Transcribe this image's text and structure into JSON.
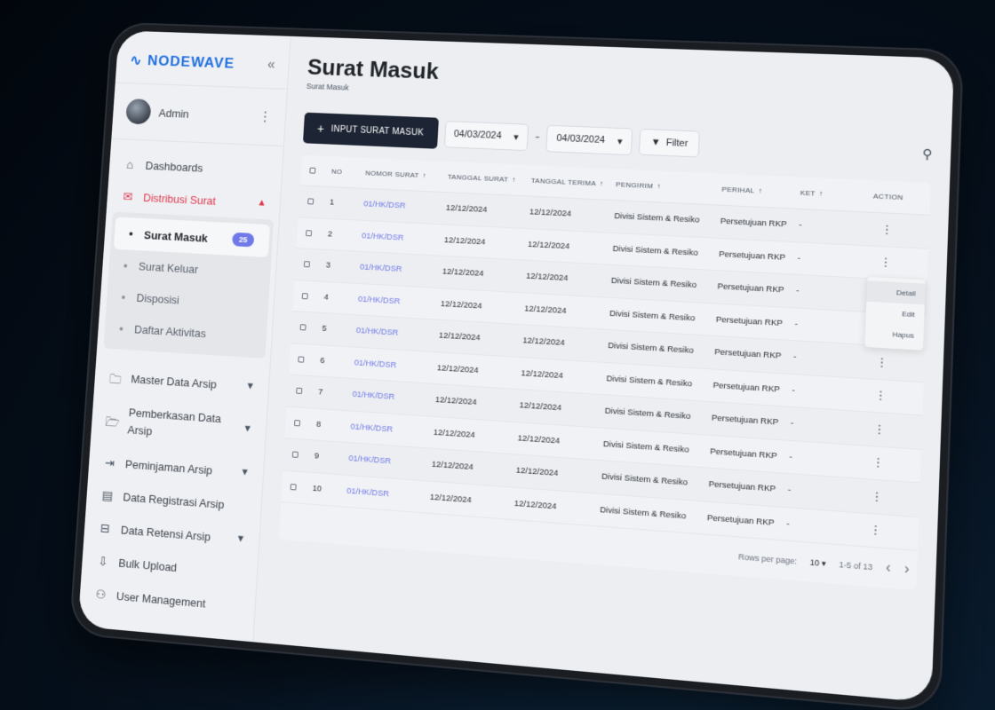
{
  "brand": {
    "name": "NODEWAVE",
    "collapse_icon": "double-chevron-left-icon"
  },
  "user": {
    "name": "Admin"
  },
  "nav": {
    "dashboards": "Dashboards",
    "distribusi": "Distribusi Surat",
    "sub": [
      {
        "label": "Surat Masuk",
        "badge": "25"
      },
      {
        "label": "Surat Keluar"
      },
      {
        "label": "Disposisi"
      },
      {
        "label": "Daftar Aktivitas"
      }
    ],
    "master": "Master Data Arsip",
    "pemberkasan": "Pemberkasan Data Arsip",
    "peminjaman": "Peminjaman Arsip",
    "registrasi": "Data Registrasi Arsip",
    "retensi": "Data Retensi Arsip",
    "bulk": "Bulk Upload",
    "usermgmt": "User Management"
  },
  "page": {
    "title": "Surat Masuk",
    "breadcrumb": "Surat Masuk"
  },
  "toolbar": {
    "input_label": "INPUT SURAT MASUK",
    "date_from": "04/03/2024",
    "date_to": "04/03/2024",
    "separator": "-",
    "filter_label": "Filter"
  },
  "table": {
    "headers": {
      "no": "NO",
      "nomor": "NOMOR SURAT",
      "tgl_surat": "TANGGAL SURAT",
      "tgl_terima": "TANGGAL TERIMA",
      "pengirim": "PENGIRIM",
      "perihal": "PERIHAL",
      "ket": "KET",
      "action": "ACTION"
    },
    "rows": [
      {
        "no": "1",
        "nomor": "01/HK/DSR",
        "tgl_surat": "12/12/2024",
        "tgl_terima": "12/12/2024",
        "pengirim": "Divisi Sistem & Resiko",
        "perihal": "Persetujuan RKP",
        "ket": "-"
      },
      {
        "no": "2",
        "nomor": "01/HK/DSR",
        "tgl_surat": "12/12/2024",
        "tgl_terima": "12/12/2024",
        "pengirim": "Divisi Sistem & Resiko",
        "perihal": "Persetujuan RKP",
        "ket": "-"
      },
      {
        "no": "3",
        "nomor": "01/HK/DSR",
        "tgl_surat": "12/12/2024",
        "tgl_terima": "12/12/2024",
        "pengirim": "Divisi Sistem & Resiko",
        "perihal": "Persetujuan RKP",
        "ket": "-"
      },
      {
        "no": "4",
        "nomor": "01/HK/DSR",
        "tgl_surat": "12/12/2024",
        "tgl_terima": "12/12/2024",
        "pengirim": "Divisi Sistem & Resiko",
        "perihal": "Persetujuan RKP",
        "ket": "-"
      },
      {
        "no": "5",
        "nomor": "01/HK/DSR",
        "tgl_surat": "12/12/2024",
        "tgl_terima": "12/12/2024",
        "pengirim": "Divisi Sistem & Resiko",
        "perihal": "Persetujuan RKP",
        "ket": "-"
      },
      {
        "no": "6",
        "nomor": "01/HK/DSR",
        "tgl_surat": "12/12/2024",
        "tgl_terima": "12/12/2024",
        "pengirim": "Divisi Sistem & Resiko",
        "perihal": "Persetujuan RKP",
        "ket": "-"
      },
      {
        "no": "7",
        "nomor": "01/HK/DSR",
        "tgl_surat": "12/12/2024",
        "tgl_terima": "12/12/2024",
        "pengirim": "Divisi Sistem & Resiko",
        "perihal": "Persetujuan RKP",
        "ket": "-"
      },
      {
        "no": "8",
        "nomor": "01/HK/DSR",
        "tgl_surat": "12/12/2024",
        "tgl_terima": "12/12/2024",
        "pengirim": "Divisi Sistem & Resiko",
        "perihal": "Persetujuan RKP",
        "ket": "-"
      },
      {
        "no": "9",
        "nomor": "01/HK/DSR",
        "tgl_surat": "12/12/2024",
        "tgl_terima": "12/12/2024",
        "pengirim": "Divisi Sistem & Resiko",
        "perihal": "Persetujuan RKP",
        "ket": "-"
      },
      {
        "no": "10",
        "nomor": "01/HK/DSR",
        "tgl_surat": "12/12/2024",
        "tgl_terima": "12/12/2024",
        "pengirim": "Divisi Sistem & Resiko",
        "perihal": "Persetujuan RKP",
        "ket": "-"
      }
    ]
  },
  "action_menu": {
    "detail": "Detail",
    "edit": "Edit",
    "hapus": "Hapus"
  },
  "pager": {
    "rows_label": "Rows per page:",
    "rows_value": "10",
    "range": "1-5 of 13"
  },
  "colors": {
    "accent": "#e0384f",
    "link": "#6f79e8",
    "primary_btn": "#1d2433"
  }
}
